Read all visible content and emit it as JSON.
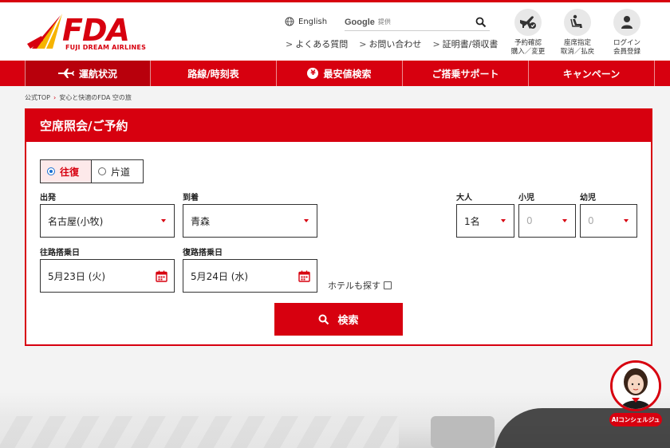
{
  "header": {
    "logo_text": "FDA",
    "logo_sub": "FUJI DREAM AIRLINES",
    "language": "English",
    "search": {
      "brand": "Google",
      "brand_sub": "提供"
    },
    "links": [
      "よくある質問",
      "お問い合わせ",
      "証明書/領収書"
    ],
    "icons": [
      {
        "icon": "plane-check-icon",
        "label1": "予約確認",
        "label2": "購入／変更"
      },
      {
        "icon": "seat-icon",
        "label1": "座席指定",
        "label2": "取消／払戻"
      },
      {
        "icon": "user-icon",
        "label1": "ログイン",
        "label2": "会員登録"
      }
    ]
  },
  "nav": {
    "items": [
      "運航状況",
      "路線/時刻表",
      "最安値検索",
      "ご搭乗サポート",
      "キャンペーン"
    ],
    "yen_symbol": "¥"
  },
  "breadcrumb": [
    "公式TOP",
    "安心と快適のFDA 空の旅"
  ],
  "form": {
    "title": "空席照会/ご予約",
    "trip_types": [
      "往復",
      "片道"
    ],
    "selected_trip": "往復",
    "departure_label": "出発",
    "departure_value": "名古屋(小牧)",
    "arrival_label": "到着",
    "arrival_value": "青森",
    "adult_label": "大人",
    "adult_value": "1名",
    "child_label": "小児",
    "child_value": "0",
    "infant_label": "幼児",
    "infant_value": "0",
    "outbound_label": "往路搭乗日",
    "outbound_value": "5月23日 (火)",
    "return_label": "復路搭乗日",
    "return_value": "5月24日 (水)",
    "hotel_label": "ホテルも探す",
    "search_button": "検索"
  },
  "ai_concierge": {
    "label": "AIコンシェルジュ"
  },
  "colors": {
    "brand_red": "#d7000f",
    "radio_blue": "#1a6fd1"
  }
}
